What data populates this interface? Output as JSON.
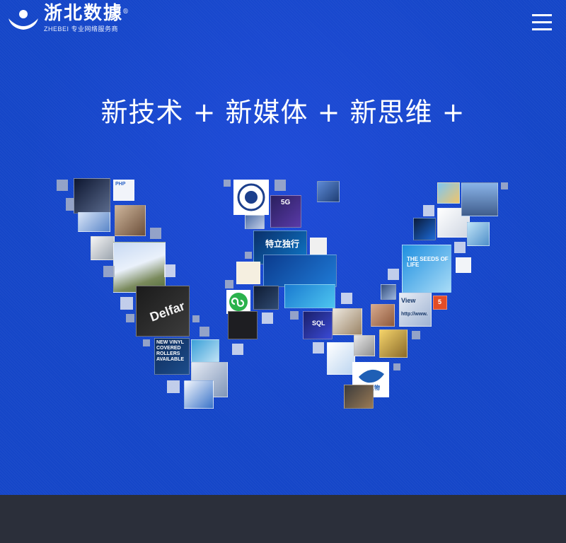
{
  "brand": {
    "name_cn": "浙北数據",
    "registered": "®",
    "subtitle": "ZHEBEI 专业网络服务商"
  },
  "headline": "新技术 + 新媒体 + 新思维 +",
  "collage": {
    "tiles": [
      {
        "label": "PHP"
      },
      {
        "label": "5G"
      },
      {
        "label": "特立独行"
      },
      {
        "label": "SQL"
      },
      {
        "label": "THE SEEDS OF LIFE"
      },
      {
        "label": "Delfar"
      },
      {
        "label": "NEW VINYL COVERED ROLLERS AVAILABLE"
      },
      {
        "label": "新使生物"
      },
      {
        "label": "View"
      },
      {
        "label": "http://www."
      },
      {
        "label": "5"
      }
    ]
  },
  "colors": {
    "hero_bg": "#1546c8",
    "footer_bg": "#2b2f3a",
    "text": "#ffffff"
  },
  "icons": [
    "logo-mark-icon",
    "hamburger-menu-icon",
    "html5-icon",
    "mini-program-icon"
  ]
}
